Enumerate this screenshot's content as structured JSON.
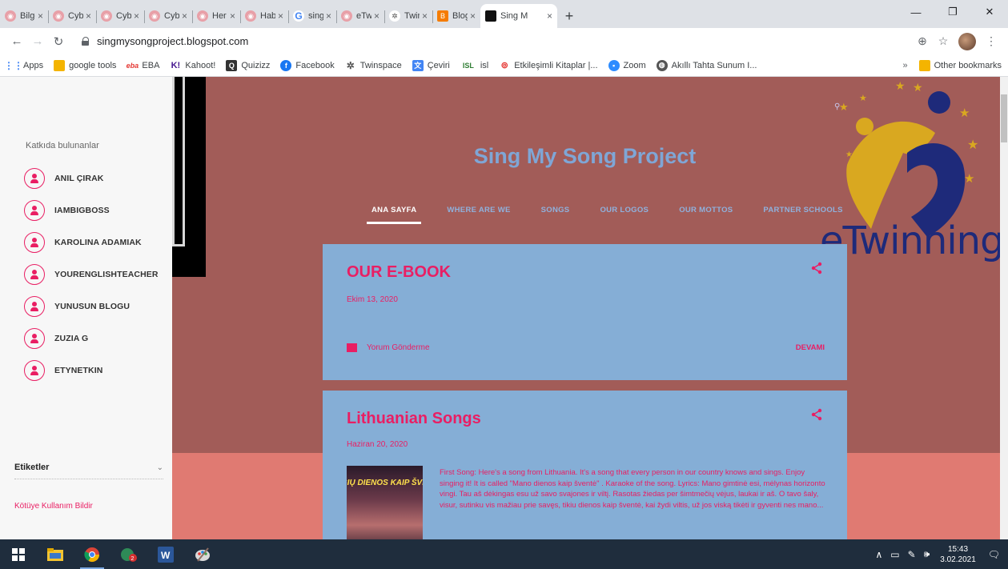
{
  "browser": {
    "tabs": [
      {
        "title": "Bilgen",
        "color": "#e8a0a8"
      },
      {
        "title": "Cyberb",
        "color": "#e8a0a8"
      },
      {
        "title": "Cyberb",
        "color": "#e8a0a8"
      },
      {
        "title": "Cyberb",
        "color": "#e8a0a8"
      },
      {
        "title": "Her Zo",
        "color": "#e8a0a8"
      },
      {
        "title": "Haberl",
        "color": "#e8a0a8"
      },
      {
        "title": "sing m",
        "color": "#4285f4"
      },
      {
        "title": "eTwinn",
        "color": "#e8a0a8"
      },
      {
        "title": "Twinsp",
        "color": "#555555"
      },
      {
        "title": "Blogge",
        "color": "#f57c00"
      },
      {
        "title": "Sing M",
        "color": "#111111"
      }
    ],
    "close_glyph": "×",
    "new_tab_glyph": "+",
    "url": "singmysongproject.blogspot.com",
    "bookmarks": [
      {
        "label": "Apps",
        "color": "#4285f4"
      },
      {
        "label": "google tools",
        "color": "#f4b400"
      },
      {
        "label": "EBA",
        "color": "#e53935"
      },
      {
        "label": "Kahoot!",
        "color": "#46178f"
      },
      {
        "label": "Quizizz",
        "color": "#333333"
      },
      {
        "label": "Facebook",
        "color": "#1877f2"
      },
      {
        "label": "Twinspace",
        "color": "#555555"
      },
      {
        "label": "Çeviri",
        "color": "#4285f4"
      },
      {
        "label": "isl",
        "color": "#2e7d32"
      },
      {
        "label": "Etkileşimli Kitaplar |...",
        "color": "#e53935"
      },
      {
        "label": "Zoom",
        "color": "#2d8cff"
      },
      {
        "label": "Akıllı Tahta Sunum I...",
        "color": "#555555"
      }
    ],
    "bookmarks_overflow": "»",
    "other_bookmarks": "Other bookmarks"
  },
  "sidebar": {
    "heading": "Katkıda bulunanlar",
    "contributors": [
      "ANIL ÇIRAK",
      "IAMBIGBOSS",
      "KAROLINA ADAMIAK",
      "YOURENGLISHTEACHER",
      "YUNUSUN BLOGU",
      "ZUZIA G",
      "ETYNETKIN"
    ],
    "labels_title": "Etiketler",
    "labels_chevron": "⌄",
    "report_link": "Kötüye Kullanım Bildir"
  },
  "blog": {
    "title": "Sing My Song Project",
    "nav": [
      "ANA SAYFA",
      "WHERE ARE WE",
      "SONGS",
      "OUR LOGOS",
      "OUR MOTTOS",
      "PARTNER SCHOOLS"
    ],
    "logo_text": "eTwinning"
  },
  "posts": [
    {
      "title": "OUR E-BOOK",
      "date": "Ekim 13, 2020",
      "comment_label": "Yorum Gönderme",
      "read_more": "DEVAMI"
    },
    {
      "title": "Lithuanian Songs",
      "date": "Haziran 20, 2020",
      "thumb_caption": "ŠIŲ DIENOS KAIP ŠVEN",
      "excerpt": "First Song: Here's a song from Lithuania. It's a song that every person in our country knows and sings. Enjoy singing it! It is called \"Mano dienos kaip šventė\" . Karaoke of the song. Lyrics: Mano gimtinė esi, mėlynas horizonto vingi. Tau aš dėkingas esu už savo svajones ir viltį. Rasotas žiedas per šimtmečių vėjus, laukai ir aš. O tavo šaly, visur, sutinku vis mažiau prie savęs, tikiu dienos kaip šventė, kai žydi viltis, už jos viską tikėti ir gyventi nes mano..."
    }
  ],
  "taskbar": {
    "time": "15:43",
    "date": "3.02.2021"
  }
}
